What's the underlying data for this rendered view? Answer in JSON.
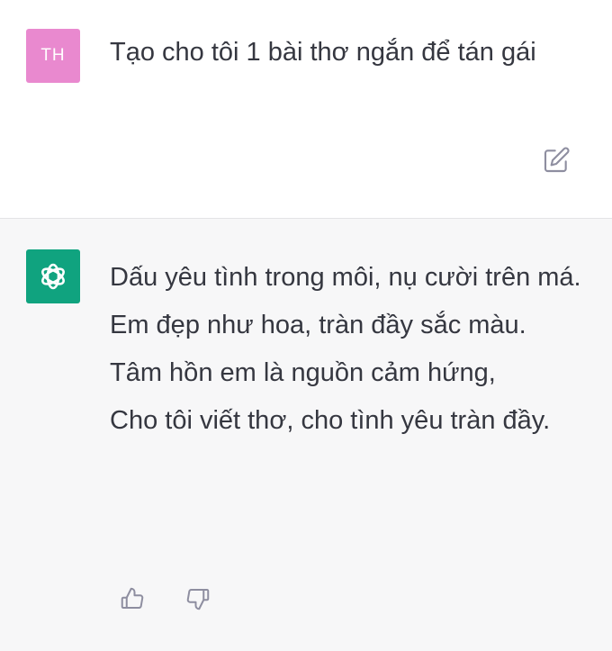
{
  "user_message": {
    "avatar_initials": "TH",
    "avatar_color": "#e989cf",
    "text": "Tạo cho tôi 1 bài thơ ngắn để tán gái"
  },
  "assistant_message": {
    "avatar_icon": "openai-logo-icon",
    "avatar_color": "#10a37f",
    "lines": [
      "Dấu yêu tình trong môi, nụ cười trên má.",
      "Em đẹp như hoa, tràn đầy sắc màu.",
      "Tâm hồn em là nguồn cảm hứng,",
      "Cho tôi viết thơ, cho tình yêu tràn đầy."
    ]
  },
  "icons": {
    "edit": "edit-icon",
    "like": "thumbs-up-icon",
    "dislike": "thumbs-down-icon"
  }
}
